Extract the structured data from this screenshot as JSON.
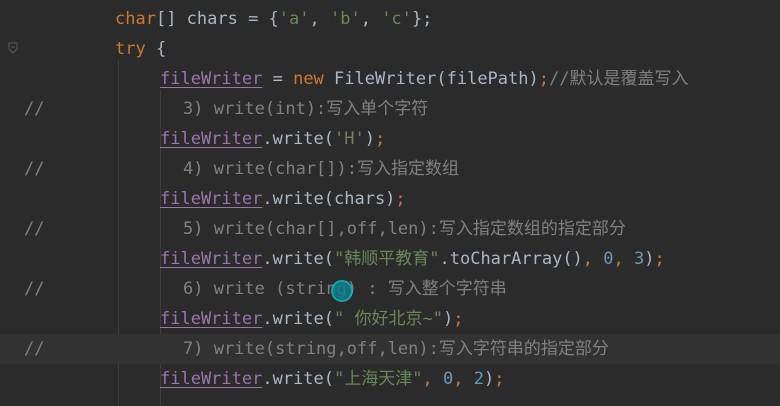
{
  "editor": {
    "lines": [
      {
        "parts": [
          {
            "t": "char",
            "c": "kw"
          },
          {
            "t": "[] chars = {",
            "c": ""
          },
          {
            "t": "'a'",
            "c": "str"
          },
          {
            "t": ", ",
            "c": ""
          },
          {
            "t": "'b'",
            "c": "str"
          },
          {
            "t": ", ",
            "c": ""
          },
          {
            "t": "'c'",
            "c": "str"
          },
          {
            "t": "};",
            "c": ""
          }
        ]
      },
      {
        "parts": [
          {
            "t": "try",
            "c": "kw"
          },
          {
            "t": " {",
            "c": ""
          }
        ]
      },
      {
        "parts": [
          {
            "t": "fileWriter",
            "c": "field"
          },
          {
            "t": " = ",
            "c": ""
          },
          {
            "t": "new",
            "c": "kw"
          },
          {
            "t": " FileWriter(filePath)",
            "c": ""
          },
          {
            "t": ";",
            "c": "kw"
          },
          {
            "t": "//默认是覆盖写入",
            "c": "cmt"
          }
        ]
      },
      {
        "comment_prefix": "//",
        "parts": [
          {
            "t": "3) write(int):写入单个字符",
            "c": "cmt"
          }
        ]
      },
      {
        "parts": [
          {
            "t": "fileWriter",
            "c": "field"
          },
          {
            "t": ".write(",
            "c": ""
          },
          {
            "t": "'H'",
            "c": "str"
          },
          {
            "t": ")",
            "c": ""
          },
          {
            "t": ";",
            "c": "kw"
          }
        ]
      },
      {
        "comment_prefix": "//",
        "parts": [
          {
            "t": "4) write(char[]):写入指定数组",
            "c": "cmt"
          }
        ]
      },
      {
        "parts": [
          {
            "t": "fileWriter",
            "c": "field"
          },
          {
            "t": ".write(chars)",
            "c": ""
          },
          {
            "t": ";",
            "c": "kw"
          }
        ]
      },
      {
        "comment_prefix": "//",
        "parts": [
          {
            "t": "5) write(char[],off,len):写入指定数组的指定部分",
            "c": "cmt"
          }
        ]
      },
      {
        "parts": [
          {
            "t": "fileWriter",
            "c": "field"
          },
          {
            "t": ".write(",
            "c": ""
          },
          {
            "t": "\"韩顺平教育\"",
            "c": "str"
          },
          {
            "t": ".toCharArray()",
            "c": ""
          },
          {
            "t": ", ",
            "c": "kw"
          },
          {
            "t": "0",
            "c": "num"
          },
          {
            "t": ", ",
            "c": "kw"
          },
          {
            "t": "3",
            "c": "num"
          },
          {
            "t": ")",
            "c": ""
          },
          {
            "t": ";",
            "c": "kw"
          }
        ]
      },
      {
        "comment_prefix": "//",
        "parts": [
          {
            "t": "6) write (string) : 写入整个字符串",
            "c": "cmt"
          }
        ]
      },
      {
        "parts": [
          {
            "t": "fileWriter",
            "c": "field"
          },
          {
            "t": ".write(",
            "c": ""
          },
          {
            "t": "\" 你好北京~\"",
            "c": "str"
          },
          {
            "t": ")",
            "c": ""
          },
          {
            "t": ";",
            "c": "kw"
          }
        ]
      },
      {
        "comment_prefix": "//",
        "highlight": true,
        "parts": [
          {
            "t": "7) write(string,off,len):写入字符串的指定部分",
            "c": "cmt"
          }
        ]
      },
      {
        "parts": [
          {
            "t": "fileWriter",
            "c": "field"
          },
          {
            "t": ".write(",
            "c": ""
          },
          {
            "t": "\"上海天津\"",
            "c": "str"
          },
          {
            "t": ", ",
            "c": "kw"
          },
          {
            "t": "0",
            "c": "num"
          },
          {
            "t": ", ",
            "c": "kw"
          },
          {
            "t": "2",
            "c": "num"
          },
          {
            "t": ")",
            "c": ""
          },
          {
            "t": ";",
            "c": "kw"
          }
        ]
      }
    ]
  },
  "icons": {
    "fold": "fold-marker-icon",
    "cursor": "cursor-highlight-icon"
  },
  "colors": {
    "background": "#2b2b2b",
    "keyword": "#cc7832",
    "string": "#6a8759",
    "number": "#6897bb",
    "field": "#9876aa",
    "comment": "#808080",
    "text": "#a9b7c6"
  }
}
